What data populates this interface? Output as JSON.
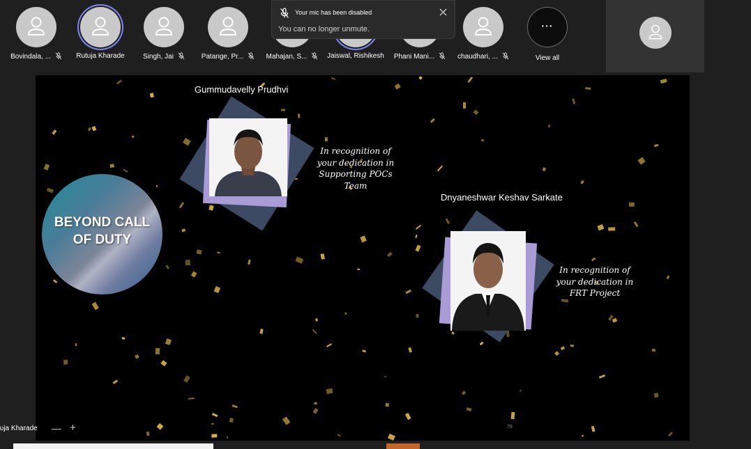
{
  "participants": [
    {
      "name": "Bovindala, ...",
      "muted": true,
      "active": false
    },
    {
      "name": "Rutuja Kharade",
      "muted": false,
      "active": true
    },
    {
      "name": "Singh, Jai",
      "muted": true,
      "active": false
    },
    {
      "name": "Patange, Pr...",
      "muted": true,
      "active": false
    },
    {
      "name": "Mahajan, S...",
      "muted": true,
      "active": false
    },
    {
      "name": "Jaiswal, Rishikesh",
      "muted": false,
      "active": true
    },
    {
      "name": "Phani Mani...",
      "muted": true,
      "active": false
    },
    {
      "name": "chaudhari, ...",
      "muted": true,
      "active": false
    }
  ],
  "view_all": {
    "icon": "more-dots",
    "label": "View all"
  },
  "toast": {
    "title": "Your mic has been disabled",
    "body": "You can no longer unmute.",
    "icon": "mic-off-icon",
    "close_icon": "close-icon"
  },
  "slide": {
    "badge_line1": "BEYOND CALL",
    "badge_line2": "OF DUTY",
    "awardee1": {
      "name": "Gummudavelly  Prudhvi",
      "recognition": [
        "In recognition of",
        "your dedication in",
        "Supporting POCs",
        "Team"
      ]
    },
    "awardee2": {
      "name": "Dnyaneshwar   Keshav Sarkate",
      "recognition": [
        "In recognition of",
        "your dedication in",
        "FRT  Project"
      ]
    },
    "slide_number": "79"
  },
  "presenter": {
    "name": "tuja Kharade"
  },
  "zoom": {
    "minus": "—",
    "plus": "+"
  },
  "colors": {
    "accent": "#7f85f5",
    "confetti": "#d8b24a",
    "frame_dark": "#3d4a63",
    "frame_light": "#a89bd6"
  }
}
